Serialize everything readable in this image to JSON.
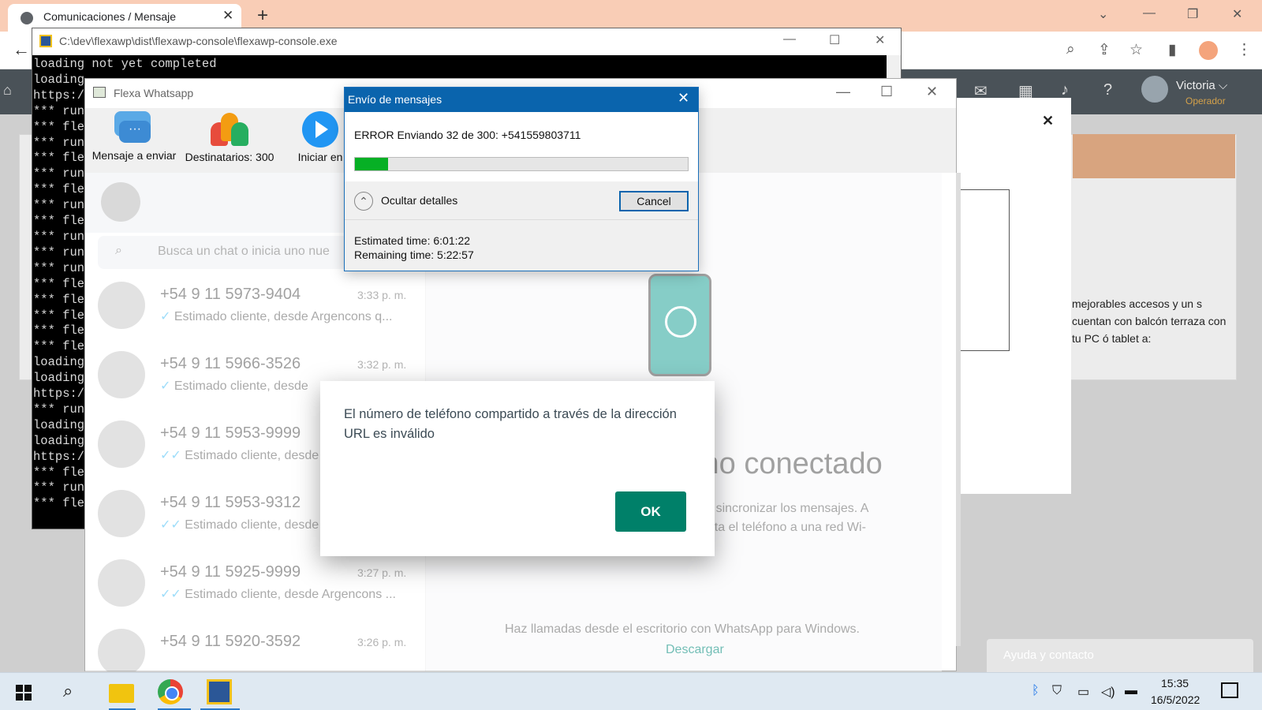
{
  "browser": {
    "tab_title": "Comunicaciones / Mensaje",
    "tab_close": "✕",
    "new_tab": "+",
    "back": "←"
  },
  "webapp": {
    "user_name": "Victoria ⌵",
    "user_role": "Operador",
    "modal_close": "✕",
    "text_fragment": "mejorables accesos y un s cuentan con balcón terraza con tu PC ó tablet a:",
    "help_button": "Ayuda y contacto"
  },
  "console": {
    "title": "C:\\dev\\flexawp\\dist\\flexawp-console\\flexawp-console.exe",
    "lines": "loading not yet completed\nloading\nhttps:/\n*** run\n*** fle\n*** run\n*** fle\n*** run\n*** fle\n*** run\n*** fle\n*** run\n*** run\n*** run\n*** fle\n*** fle\n*** fle\n*** fle\n*** fle\nloading\nloading\nhttps:/\n*** run\nloading\nloading\nhttps:/\n*** fle\n*** run\n*** fle"
  },
  "flexa": {
    "title": "Flexa Whatsapp",
    "tool_message_label": "Mensaje a enviar",
    "tool_recipients_label": "Destinatarios: 300",
    "tool_start_label": "Iniciar en"
  },
  "whatsapp": {
    "search_placeholder": "Busca un chat o inicia uno nue",
    "chats": [
      {
        "name": "+54 9 11 5973-9404",
        "time": "3:33 p. m.",
        "preview": "Estimado cliente, desde Argencons q..."
      },
      {
        "name": "+54 9 11 5966-3526",
        "time": "3:32 p. m.",
        "preview": "Estimado cliente, desde"
      },
      {
        "name": "+54 9 11 5953-9999",
        "time": "",
        "preview": "Estimado cliente, desde"
      },
      {
        "name": "+54 9 11 5953-9312",
        "time": "",
        "preview": "Estimado cliente, desde"
      },
      {
        "name": "+54 9 11 5925-9999",
        "time": "3:27 p. m.",
        "preview": "Estimado cliente, desde Argencons ..."
      },
      {
        "name": "+54 9 11 5920-3592",
        "time": "3:26 p. m.",
        "preview": ""
      }
    ],
    "connected_text": "mo conectado",
    "sub_text": "ara sincronizar los mensajes. A necta el teléfono a una red Wi-",
    "calls_text": "Haz llamadas desde el escritorio con WhatsApp para Windows.",
    "download_link": "Descargar",
    "alert_message": "El número de teléfono compartido a través de la dirección URL es inválido",
    "ok_button": "OK"
  },
  "progress_dialog": {
    "title": "Envío de mensajes",
    "status": "ERROR Enviando 32 de 300: +541559803711",
    "progress_fraction": 0.1,
    "details_toggle": "Ocultar detalles",
    "cancel_button": "Cancel",
    "estimated_time": "Estimated time: 6:01:22",
    "remaining_time": "Remaining time: 5:22:57"
  },
  "taskbar": {
    "time": "15:35",
    "date": "16/5/2022"
  },
  "colors": {
    "progress_fill": "#06b025",
    "dialog_titlebar": "#0a64ad",
    "whatsapp_green": "#008069",
    "chrome_titlebar": "#f9cdb6"
  }
}
